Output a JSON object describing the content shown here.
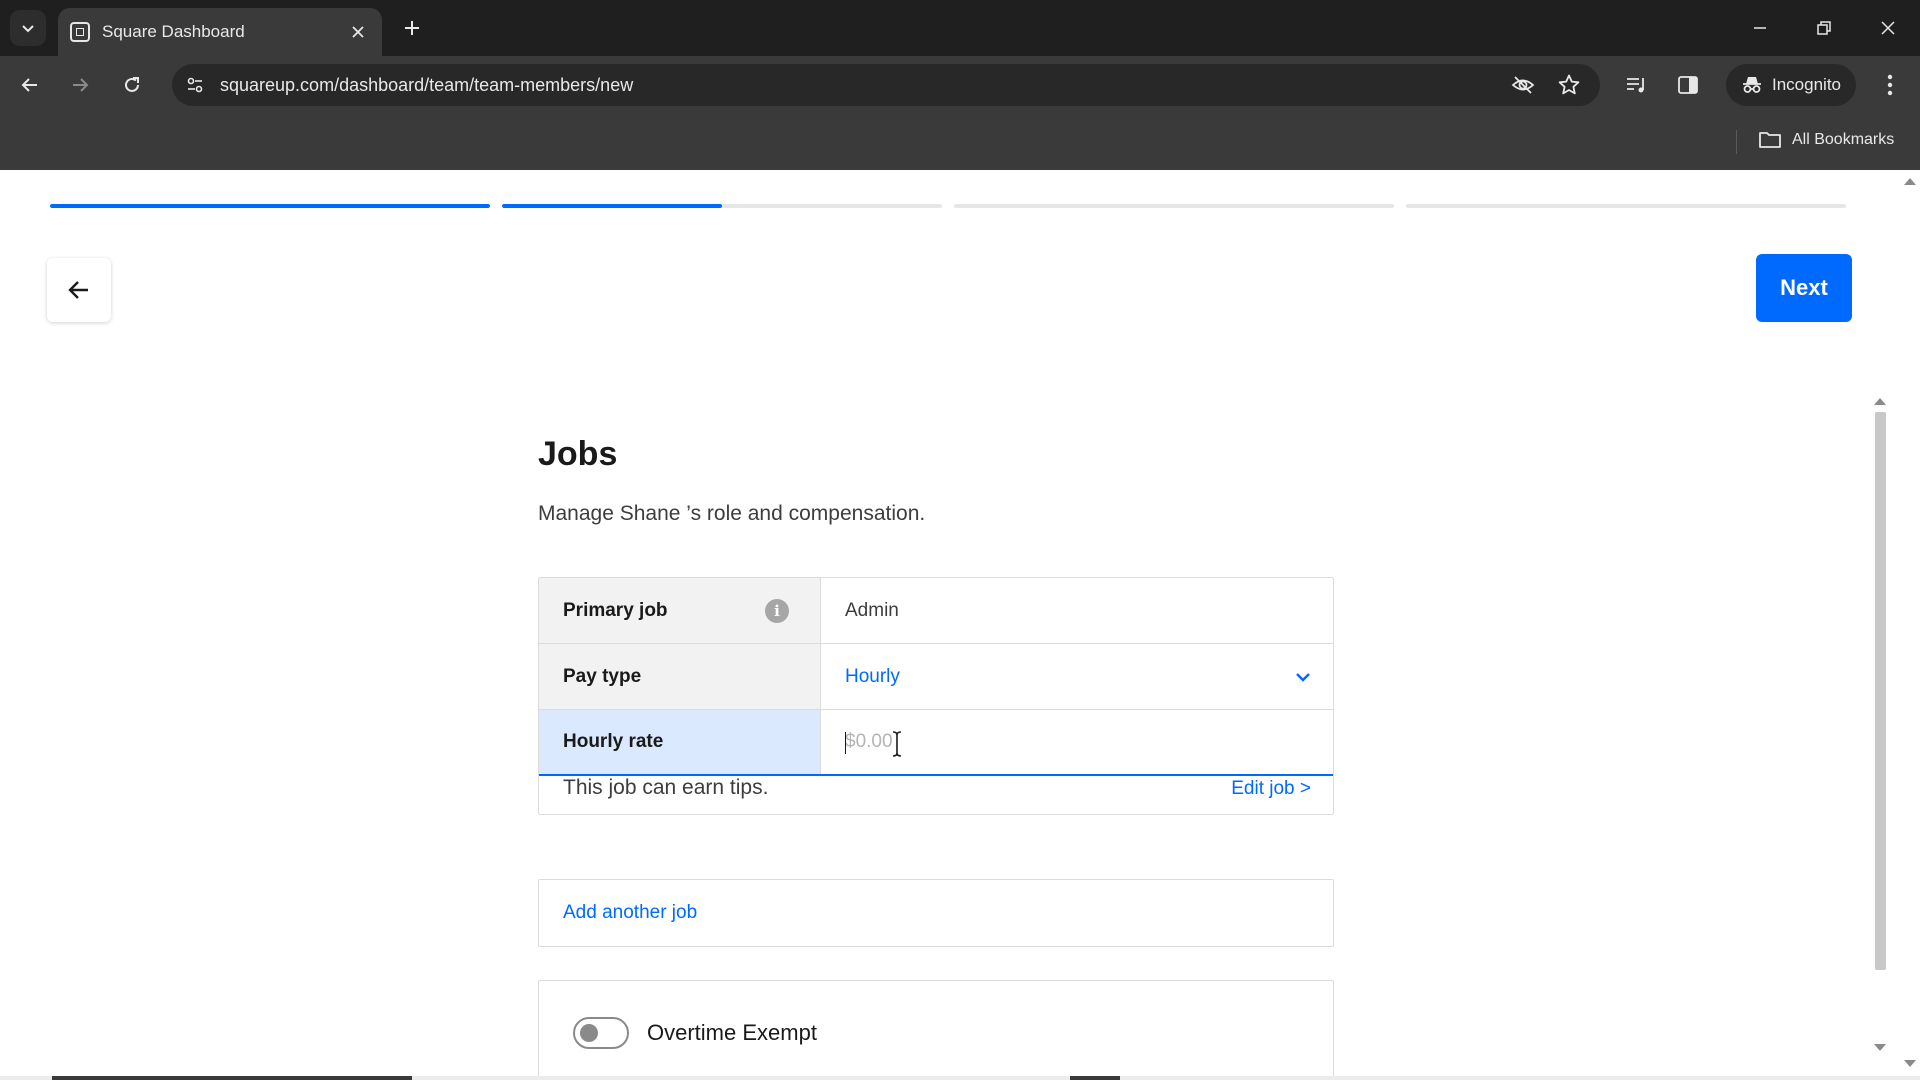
{
  "browser": {
    "tab_title": "Square Dashboard",
    "url": "squareup.com/dashboard/team/team-members/new",
    "incognito_label": "Incognito",
    "bookmarks_label": "All Bookmarks"
  },
  "stepper": {
    "steps": [
      {
        "fill": 1.0
      },
      {
        "fill": 0.5
      },
      {
        "fill": 0.0
      },
      {
        "fill": 0.0
      }
    ]
  },
  "header": {
    "next_label": "Next"
  },
  "jobs": {
    "title": "Jobs",
    "subtitle": "Manage Shane ’s role and compensation.",
    "primary_job_label": "Primary job",
    "primary_job_value": "Admin",
    "pay_type_label": "Pay type",
    "pay_type_value": "Hourly",
    "hourly_rate_label": "Hourly rate",
    "hourly_rate_placeholder": "$0.00",
    "tips_text": "This job can earn tips.",
    "edit_job_label": "Edit job >",
    "add_job_label": "Add another job",
    "overtime_label": "Overtime Exempt"
  },
  "colors": {
    "accent": "#006aff",
    "active_row": "#dbe9ff",
    "label_bg": "#f2f2f2"
  }
}
